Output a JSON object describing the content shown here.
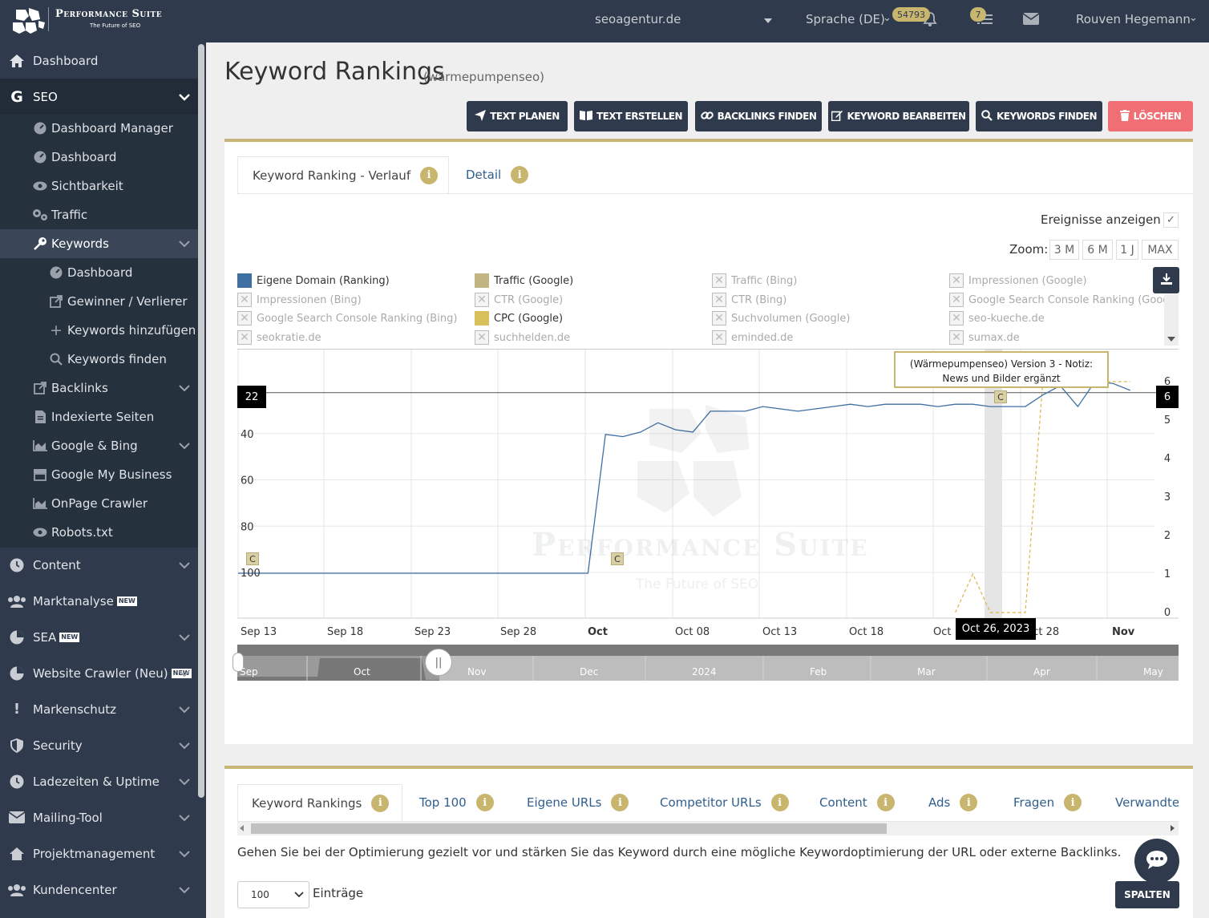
{
  "topbar": {
    "brand": "Performance Suite",
    "tagline": "The Future of SEO",
    "project": "seoagentur.de",
    "language": "Sprache (DE)",
    "notif_count": "54793",
    "task_count": "7",
    "user": "Rouven Hegemann"
  },
  "sidebar": {
    "dashboard": "Dashboard",
    "seo": "SEO",
    "seo_items": {
      "dashboard_manager": "Dashboard Manager",
      "dashboard": "Dashboard",
      "sichtbarkeit": "Sichtbarkeit",
      "traffic": "Traffic",
      "keywords": "Keywords",
      "kw_dashboard": "Dashboard",
      "kw_gewinner": "Gewinner / Verlierer",
      "kw_hinzufuegen": "Keywords hinzufügen",
      "kw_finden": "Keywords finden",
      "backlinks": "Backlinks",
      "indexierte": "Indexierte Seiten",
      "google_bing": "Google & Bing",
      "gmb": "Google My Business",
      "onpage": "OnPage Crawler",
      "robots": "Robots.txt"
    },
    "content": "Content",
    "marktanalyse": "Marktanalyse",
    "sea": "SEA",
    "website_crawler": "Website Crawler (Neu)",
    "markenschutz": "Markenschutz",
    "security": "Security",
    "ladezeiten": "Ladezeiten & Uptime",
    "mailing": "Mailing-Tool",
    "projektmanagement": "Projektmanagement",
    "kundencenter": "Kundencenter",
    "new_badge": "NEW"
  },
  "page": {
    "title": "Keyword Rankings",
    "subtitle": "(wärmepumpenseo)"
  },
  "actions": {
    "text_planen": "TEXT PLANEN",
    "text_erstellen": "TEXT ERSTELLEN",
    "backlinks_finden": "BACKLINKS FINDEN",
    "keyword_bearbeiten": "KEYWORD BEARBEITEN",
    "keywords_finden": "KEYWORDS FINDEN",
    "loeschen": "LÖSCHEN"
  },
  "chart_card": {
    "tab_verlauf": "Keyword Ranking - Verlauf",
    "tab_detail": "Detail",
    "ereignisse": "Ereignisse anzeigen",
    "zoom_label": "Zoom:",
    "zoom_options": [
      "3 M",
      "6 M",
      "1 J",
      "MAX"
    ],
    "tooltip_line1": "(Wärmepumpenseo) Version 3 - Notiz:",
    "tooltip_line2": "News und Bilder ergänzt",
    "date_flag": "Oct 26, 2023",
    "left_flag": "22",
    "right_flag": "6",
    "watermark_title": "Performance Suite",
    "watermark_sub": "The Future of SEO",
    "event_marker": "C"
  },
  "chart_data": {
    "type": "line",
    "legend": [
      {
        "label": "Eigene Domain (Ranking)",
        "color": "#3f6fa3",
        "active": true
      },
      {
        "label": "Traffic (Google)",
        "color": "#c3b483",
        "active": true
      },
      {
        "label": "Traffic (Bing)",
        "active": false
      },
      {
        "label": "Impressionen (Google)",
        "active": false
      },
      {
        "label": "Impressionen (Bing)",
        "active": false
      },
      {
        "label": "CTR (Google)",
        "active": false
      },
      {
        "label": "CTR (Bing)",
        "active": false
      },
      {
        "label": "Google Search Console Ranking (Googl",
        "active": false
      },
      {
        "label": "Google Search Console Ranking (Bing)",
        "active": false
      },
      {
        "label": "CPC (Google)",
        "color": "#d8c05a",
        "active": true
      },
      {
        "label": "Suchvolumen (Google)",
        "active": false
      },
      {
        "label": "seo-kueche.de",
        "active": false
      },
      {
        "label": "seokratie.de",
        "active": false
      },
      {
        "label": "suchhelden.de",
        "active": false
      },
      {
        "label": "eminded.de",
        "active": false
      },
      {
        "label": "sumax.de",
        "active": false
      }
    ],
    "x_ticks": [
      "Sep 13",
      "Sep 18",
      "Sep 23",
      "Sep 28",
      "Oct",
      "Oct 08",
      "Oct 13",
      "Oct 18",
      "Oct",
      "Oct 28",
      "Nov"
    ],
    "y_left_ticks": [
      "40",
      "60",
      "80",
      "100"
    ],
    "y_left_range": [
      100,
      20
    ],
    "y_right_ticks": [
      "6",
      "5",
      "4",
      "3",
      "2",
      "1",
      "0"
    ],
    "y_right_range": [
      0,
      6
    ],
    "series": [
      {
        "name": "Eigene Domain (Ranking)",
        "axis": "left",
        "x": [
          "Sep 13",
          "Oct 3",
          "Oct 4",
          "Oct 5",
          "Oct 6",
          "Oct 7",
          "Oct 8",
          "Oct 9",
          "Oct 10",
          "Oct 11",
          "Oct 12",
          "Oct 13",
          "Oct 14",
          "Oct 15",
          "Oct 16",
          "Oct 17",
          "Oct 18",
          "Oct 19",
          "Oct 20",
          "Oct 21",
          "Oct 22",
          "Oct 23",
          "Oct 24",
          "Oct 25",
          "Oct 26",
          "Oct 27",
          "Oct 28",
          "Oct 29",
          "Oct 30",
          "Oct 31",
          "Nov 1",
          "Nov 2",
          "Nov 3"
        ],
        "y": [
          100,
          100,
          40,
          41,
          39,
          35,
          38,
          39,
          30,
          30,
          30,
          28,
          29,
          30,
          29,
          28,
          27,
          28,
          27,
          27,
          27,
          28,
          27,
          27,
          28,
          28,
          28,
          23,
          19,
          28,
          17,
          18,
          21
        ]
      },
      {
        "name": "CPC (Google)",
        "axis": "right",
        "x": [
          "Oct 24",
          "Oct 25",
          "Oct 26",
          "Oct 27",
          "Oct 28",
          "Oct 29",
          "Oct 30",
          "Oct 31",
          "Nov 1",
          "Nov 2",
          "Nov 3"
        ],
        "y": [
          0,
          1,
          0,
          0,
          0,
          6,
          6,
          6,
          6,
          6,
          6
        ]
      }
    ],
    "navigator_labels": [
      "Sep",
      "Oct",
      "Nov",
      "Dec",
      "2024",
      "Feb",
      "Mar",
      "Apr",
      "May"
    ]
  },
  "table_card": {
    "tabs": [
      "Keyword Rankings",
      "Top 100",
      "Eigene URLs",
      "Competitor URLs",
      "Content",
      "Ads",
      "Fragen",
      "Verwandte"
    ],
    "hint": "Gehen Sie bei der Optimierung gezielt vor und stärken Sie das Keyword durch eine mögliche Keywordoptimierung der URL oder externe Backlinks.",
    "entries_value": "100",
    "entries_label": "Einträge",
    "spalten": "SPALTEN"
  }
}
